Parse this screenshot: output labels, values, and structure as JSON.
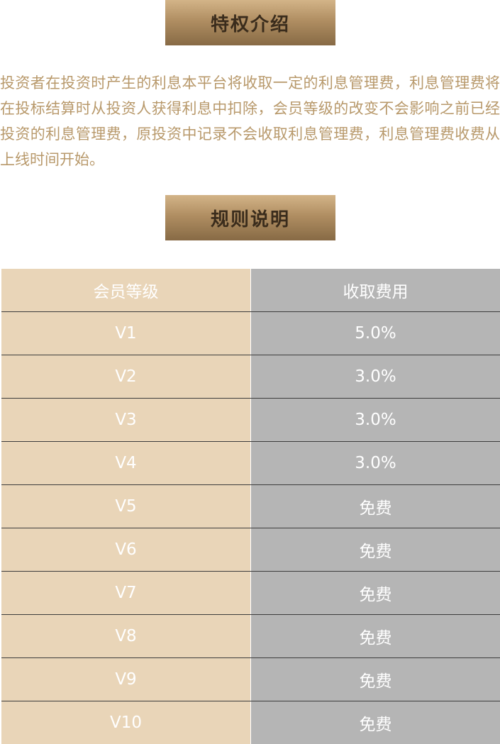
{
  "privilege_section": {
    "title": "特权介绍",
    "description": "投资者在投资时产生的利息本平台将收取一定的利息管理费，利息管理费将在投标结算时从投资人获得利息中扣除，会员等级的改变不会影响之前已经投资的利息管理费，原投资中记录不会收取利息管理费，利息管理费收费从上线时间开始。"
  },
  "rules_section": {
    "title": "规则说明",
    "table": {
      "headers": [
        "会员等级",
        "收取费用"
      ],
      "rows": [
        {
          "level": "V1",
          "fee": "5.0%"
        },
        {
          "level": "V2",
          "fee": "3.0%"
        },
        {
          "level": "V3",
          "fee": "3.0%"
        },
        {
          "level": "V4",
          "fee": "3.0%"
        },
        {
          "level": "V5",
          "fee": "免费"
        },
        {
          "level": "V6",
          "fee": "免费"
        },
        {
          "level": "V7",
          "fee": "免费"
        },
        {
          "level": "V8",
          "fee": "免费"
        },
        {
          "level": "V9",
          "fee": "免费"
        },
        {
          "level": "V10",
          "fee": "免费"
        }
      ]
    }
  },
  "colors": {
    "banner_gradient_top": "#d3b488",
    "banner_gradient_bottom": "#876a45",
    "banner_text": "#3a2c1c",
    "intro_text": "#b8996b",
    "level_column_bg": "#e9d5b8",
    "fee_column_bg": "#b5b5b5",
    "table_text": "#ffffff"
  }
}
